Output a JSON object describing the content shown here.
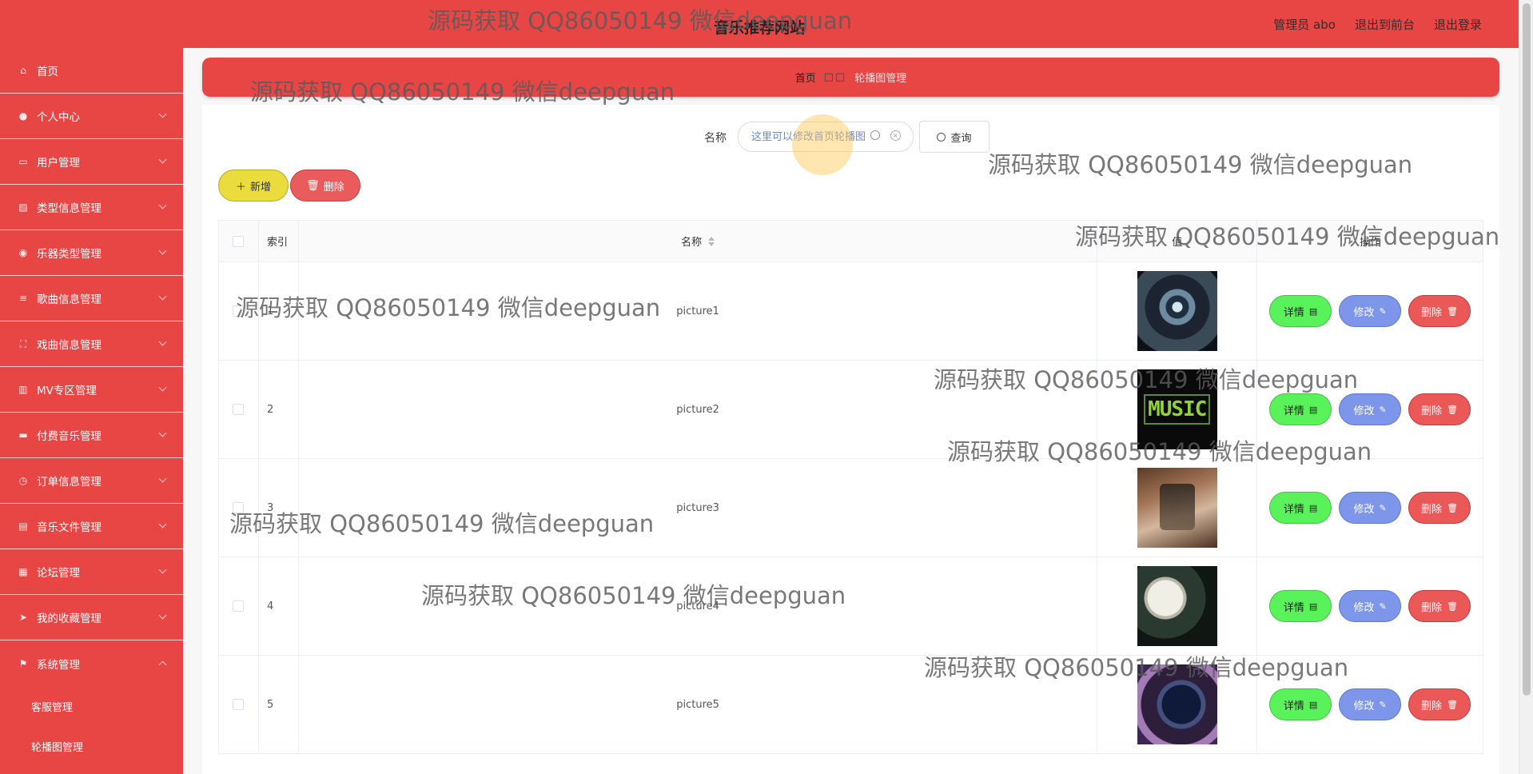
{
  "header": {
    "site_title": "音乐推荐网站",
    "links": [
      "管理员 abo",
      "退出到前台",
      "退出登录"
    ]
  },
  "sidebar": {
    "items": [
      {
        "label": "首页",
        "icon": "home-icon",
        "has_caret": false
      },
      {
        "label": "个人中心",
        "icon": "user-icon",
        "has_caret": true
      },
      {
        "label": "用户管理",
        "icon": "users-icon",
        "has_caret": true
      },
      {
        "label": "类型信息管理",
        "icon": "chart-icon",
        "has_caret": true
      },
      {
        "label": "乐器类型管理",
        "icon": "pin-icon",
        "has_caret": true
      },
      {
        "label": "歌曲信息管理",
        "icon": "sliders-icon",
        "has_caret": true
      },
      {
        "label": "戏曲信息管理",
        "icon": "frame-icon",
        "has_caret": true
      },
      {
        "label": "MV专区管理",
        "icon": "bars-icon",
        "has_caret": true
      },
      {
        "label": "付费音乐管理",
        "icon": "monitor-icon",
        "has_caret": true
      },
      {
        "label": "订单信息管理",
        "icon": "clock-icon",
        "has_caret": true
      },
      {
        "label": "音乐文件管理",
        "icon": "file-icon",
        "has_caret": true
      },
      {
        "label": "论坛管理",
        "icon": "building-icon",
        "has_caret": true
      },
      {
        "label": "我的收藏管理",
        "icon": "send-icon",
        "has_caret": true
      },
      {
        "label": "系统管理",
        "icon": "flag-icon",
        "has_caret": true,
        "expanded": true
      }
    ],
    "sub_items": [
      "客服管理",
      "轮播图管理"
    ]
  },
  "breadcrumb": {
    "home": "首页",
    "separator": "□□",
    "current": "轮播图管理"
  },
  "search": {
    "label": "名称",
    "placeholder": "这里可以修改首页轮播图",
    "button": "查询"
  },
  "actions": {
    "add": "新增",
    "delete": "删除"
  },
  "table": {
    "headers": {
      "index": "索引",
      "name": "名称",
      "image": "值",
      "ops": "操作"
    },
    "rows": [
      {
        "index": "1",
        "name": "picture1",
        "thumb": "thumb-1"
      },
      {
        "index": "2",
        "name": "picture2",
        "thumb": "thumb-2",
        "thumb_text": "MUSIC"
      },
      {
        "index": "3",
        "name": "picture3",
        "thumb": "thumb-3"
      },
      {
        "index": "4",
        "name": "picture4",
        "thumb": "thumb-4"
      },
      {
        "index": "5",
        "name": "picture5",
        "thumb": "thumb-5"
      }
    ],
    "op_labels": {
      "detail": "详情",
      "edit": "修改",
      "delete": "删除"
    }
  },
  "watermark": {
    "text": "源码获取 QQ86050149 微信deepguan"
  },
  "colors": {
    "primary_red": "#e84545",
    "add_yellow": "#eadc3d",
    "detail_green": "#5af25a",
    "edit_blue": "#7d96ea",
    "delete_red": "#ea5858"
  }
}
